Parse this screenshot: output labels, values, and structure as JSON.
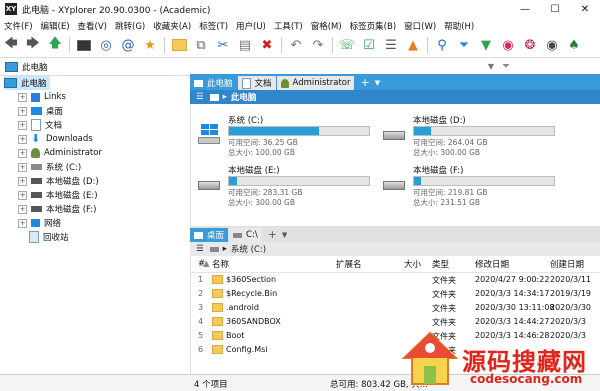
{
  "window": {
    "title": "此电脑 - XYplorer 20.90.0300 - (Academic)",
    "app_icon": "XY"
  },
  "menu": [
    "文件(F)",
    "编辑(E)",
    "查看(V)",
    "跳转(G)",
    "收藏夹(A)",
    "标签(T)",
    "用户(U)",
    "工具(T)",
    "窗格(M)",
    "标签页集(B)",
    "窗口(W)",
    "帮助(H)"
  ],
  "address": {
    "path": "此电脑"
  },
  "tree": {
    "root": "此电脑",
    "items": [
      "Links",
      "桌面",
      "文档",
      "Downloads",
      "Administrator",
      "系统 (C:)",
      "本地磁盘 (D:)",
      "本地磁盘 (E:)",
      "本地磁盘 (F:)",
      "网络",
      "回收站"
    ]
  },
  "top_pane": {
    "tabs": [
      "此电脑",
      "文档",
      "Administrator"
    ],
    "crumb": "此电脑",
    "drives": [
      {
        "name": "系统 (C:)",
        "free": "可用空间: 36.25 GB",
        "total": "总大小: 100.00 GB",
        "used_fraction": 0.64
      },
      {
        "name": "本地磁盘 (D:)",
        "free": "可用空间: 264.04 GB",
        "total": "总大小: 300.00 GB",
        "used_fraction": 0.12
      },
      {
        "name": "本地磁盘 (E:)",
        "free": "可用空间: 283.31 GB",
        "total": "总大小: 300.00 GB",
        "used_fraction": 0.06
      },
      {
        "name": "本地磁盘 (F:)",
        "free": "可用空间: 219.81 GB",
        "total": "总大小: 231.51 GB",
        "used_fraction": 0.05
      }
    ]
  },
  "bottom_pane": {
    "tabs": [
      "桌面",
      "C:\\"
    ],
    "crumb": "系统 (C:)",
    "columns": {
      "index": "#",
      "name": "名称",
      "ext": "扩展名",
      "size": "大小",
      "type": "类型",
      "modified": "修改日期",
      "created": "创建日期"
    },
    "rows": [
      {
        "n": "1",
        "name": "$360Section",
        "type": "文件夹",
        "modified": "2020/4/27 9:00:22",
        "created": "2020/3/11"
      },
      {
        "n": "2",
        "name": "$Recycle.Bin",
        "type": "文件夹",
        "modified": "2020/3/3 14:34:17",
        "created": "2019/3/19"
      },
      {
        "n": "3",
        "name": ".android",
        "type": "文件夹",
        "modified": "2020/3/30 13:11:08",
        "created": "2020/3/30"
      },
      {
        "n": "4",
        "name": "360SANDBOX",
        "type": "文件夹",
        "modified": "2020/3/3 14:44:27",
        "created": "2020/3/3"
      },
      {
        "n": "5",
        "name": "Boot",
        "type": "文件夹",
        "modified": "2020/3/3 14:46:28",
        "created": "2020/3/3"
      },
      {
        "n": "6",
        "name": "Config.Msi",
        "type": "文件夹",
        "modified": "",
        "created": ""
      }
    ]
  },
  "status": {
    "count": "4 个项目",
    "free": "总可用: 803.42 GB, 共..."
  },
  "watermark": {
    "title": "源码搜藏网",
    "url": "codesocang.com"
  }
}
